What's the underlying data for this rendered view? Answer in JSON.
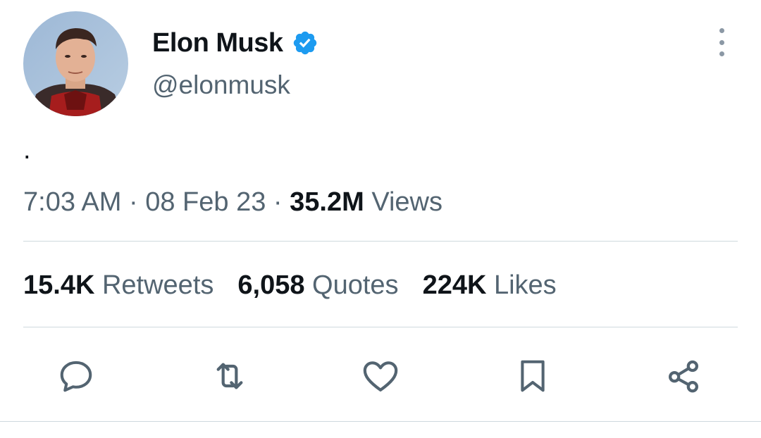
{
  "tweet": {
    "author": {
      "display_name": "Elon Musk",
      "handle": "@elonmusk",
      "verified": true,
      "avatar_icon": "profile-photo"
    },
    "text": ".",
    "timestamp": {
      "time": "7:03 AM",
      "separator": " · ",
      "date": "08 Feb 23",
      "views_count": "35.2M",
      "views_label": "Views"
    },
    "stats": [
      {
        "count": "15.4K",
        "label": "Retweets"
      },
      {
        "count": "6,058",
        "label": "Quotes"
      },
      {
        "count": "224K",
        "label": "Likes"
      }
    ],
    "actions": [
      {
        "icon": "reply-icon"
      },
      {
        "icon": "retweet-icon"
      },
      {
        "icon": "like-icon"
      },
      {
        "icon": "bookmark-icon"
      },
      {
        "icon": "share-icon"
      }
    ]
  },
  "colors": {
    "text_primary": "#0f1419",
    "text_secondary": "#536471",
    "verified_blue": "#1d9bf0",
    "divider": "#cfd9de",
    "icon": "#536471"
  }
}
